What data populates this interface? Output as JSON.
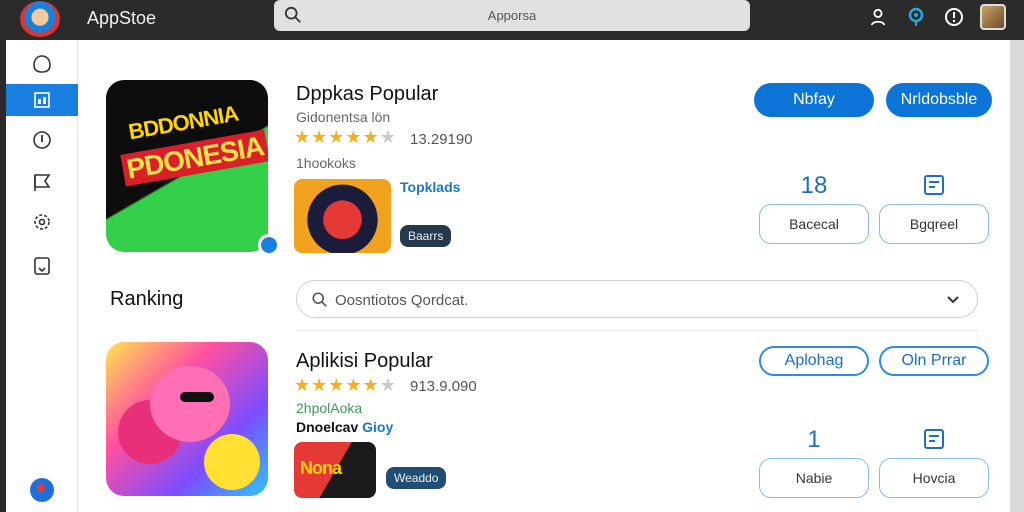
{
  "header": {
    "app_title": "AppStoe",
    "search_value": "Apporsa"
  },
  "sidebar": {
    "items": [
      {
        "icon": "home-icon",
        "active": false
      },
      {
        "icon": "grid-icon",
        "active": true
      },
      {
        "icon": "info-icon",
        "active": false
      },
      {
        "icon": "flag-icon",
        "active": false
      },
      {
        "icon": "settings-icon",
        "active": false
      },
      {
        "icon": "bookmark-icon",
        "active": false
      }
    ]
  },
  "featured": {
    "icon_text_line1": "BDDONNIA",
    "icon_text_line2": "PDONESIA",
    "title": "Dppkas Popular",
    "subtitle": "Gidonentsa lön",
    "rating_value": "13.29190",
    "stars_filled": 4.5,
    "count_line": "1hookoks",
    "link_label": "Topklads",
    "pill_label": "Baarrs",
    "btn_primary": "Nbfay",
    "btn_secondary": "Nrldobsble",
    "stat1": {
      "value": "18",
      "label": "Bacecal"
    },
    "stat2": {
      "label": "Bgqreel"
    }
  },
  "ranking": {
    "label": "Ranking",
    "select_placeholder": "Oosntiotos Qordcat."
  },
  "second": {
    "title": "Aplikisi Popular",
    "rating_value": "913.9.090",
    "stars_filled": 4.5,
    "count_line": "2hpolAoka",
    "publisher_prefix": "Dnoelcav",
    "publisher_suffix": "Gioy",
    "thumb_label": "Nona",
    "pill_label": "Weaddo",
    "btn_primary": "Aplohag",
    "btn_secondary": "Oln Prrar",
    "stat1": {
      "value": "1",
      "label": "Nabie"
    },
    "stat2": {
      "label": "Hovcia"
    }
  },
  "colors": {
    "accent": "#0b74d6",
    "star": "#f2b01e",
    "topbar": "#2b2b2b"
  }
}
